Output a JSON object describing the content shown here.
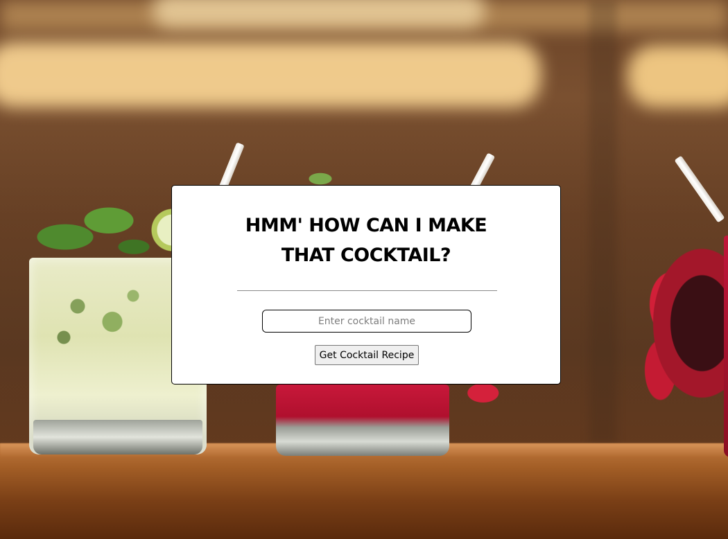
{
  "page": {
    "heading": "HMM' HOW CAN I MAKE THAT COCKTAIL?"
  },
  "search": {
    "placeholder": "Enter cocktail name",
    "value": ""
  },
  "actions": {
    "get_recipe_label": "Get Cocktail Recipe"
  },
  "background": {
    "description_icon": "bar-cocktails-photo",
    "colors": {
      "wall": "#6b4428",
      "light": "#f6d191",
      "counter": "#a35e26"
    }
  }
}
